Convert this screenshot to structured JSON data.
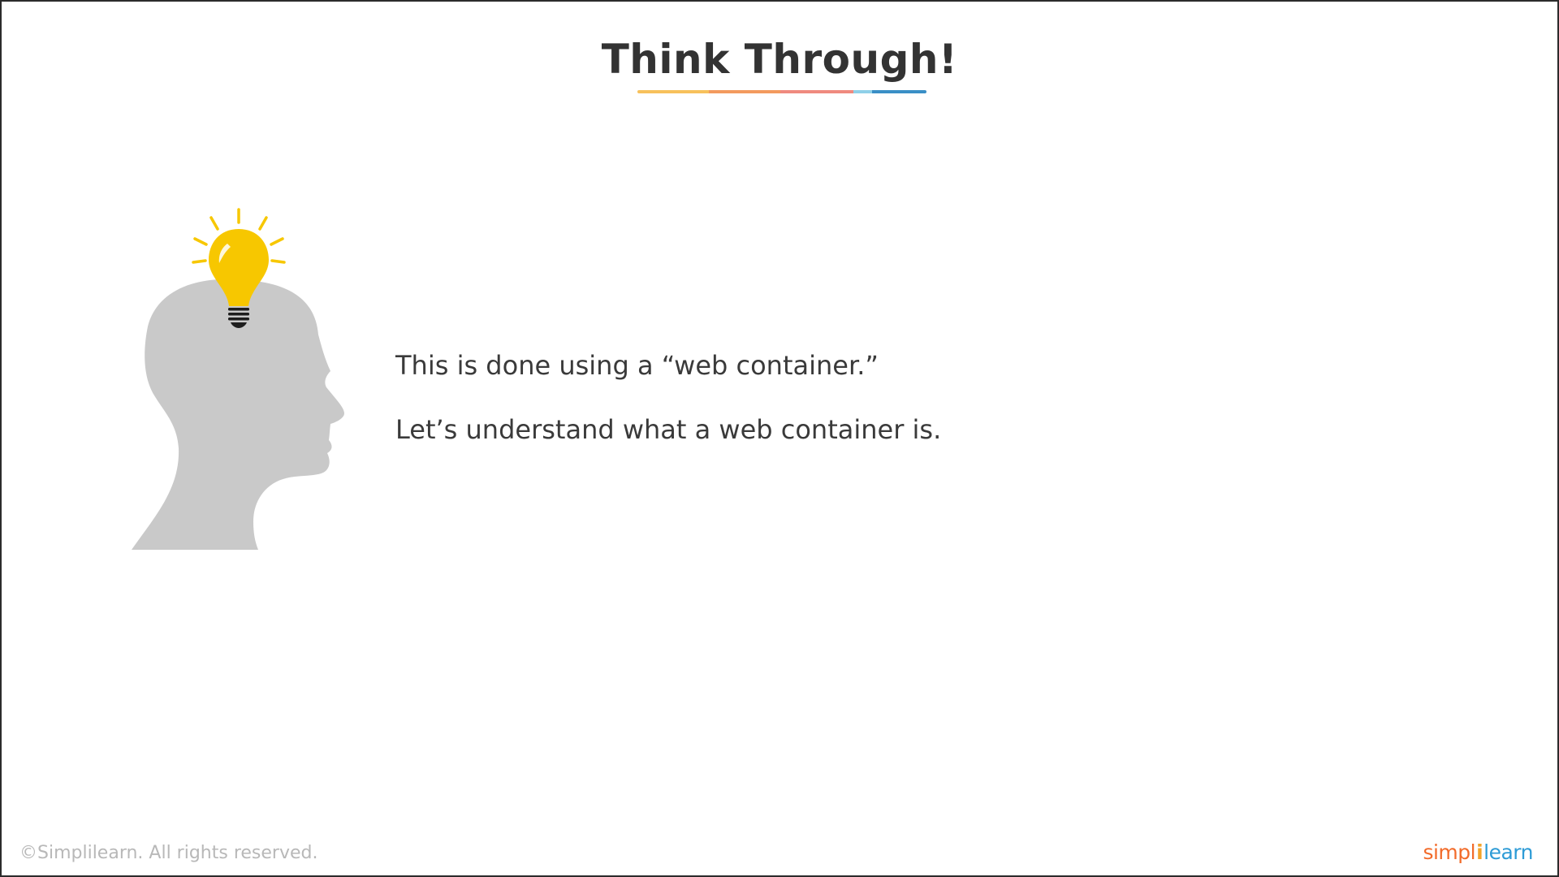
{
  "slide": {
    "title": "Think Through!",
    "underline_colors": [
      "#f7c15c",
      "#f39a5e",
      "#ef8a7f",
      "#8fd0e8",
      "#3a8fc6"
    ],
    "body_lines": [
      "This is done using a “web container.”",
      "Let’s understand what a web container is."
    ],
    "illustration": {
      "head_icon": "head-silhouette-icon",
      "bulb_icon": "lightbulb-icon",
      "head_color": "#c9c9c9",
      "bulb_color": "#f7c700"
    }
  },
  "footer": {
    "copyright": "©Simplilearn. All rights reserved.",
    "logo_part1": "simpl",
    "logo_separator": "i",
    "logo_part2": "learn",
    "logo_colors": [
      "#f26b2a",
      "#2d9bd6"
    ]
  }
}
